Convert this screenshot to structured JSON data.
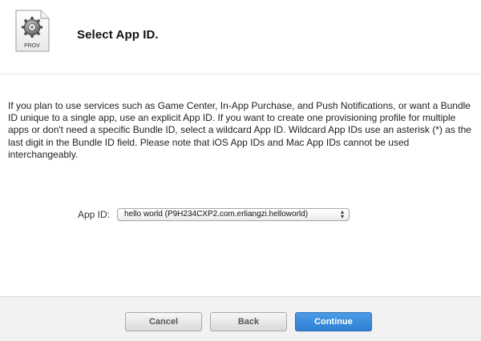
{
  "header": {
    "icon_name": "provisioning-profile-icon",
    "icon_caption": "PROV",
    "title": "Select App ID."
  },
  "description": "If you plan to use services such as Game Center, In-App Purchase, and Push Notifications, or want a Bundle ID unique to a single app, use an explicit App ID. If you want to create one provisioning profile for multiple apps or don't need a specific Bundle ID, select a wildcard App ID. Wildcard App IDs use an asterisk (*) as the last digit in the Bundle ID field. Please note that iOS App IDs and Mac App IDs cannot be used interchangeably.",
  "app_id": {
    "label": "App ID:",
    "selected_value": "hello world (P9H234CXP2.com.erliangzi.helloworld)"
  },
  "footer": {
    "cancel_label": "Cancel",
    "back_label": "Back",
    "continue_label": "Continue"
  },
  "colors": {
    "primary_button": "#3a8ad9",
    "footer_bg": "#f2f2f2"
  }
}
